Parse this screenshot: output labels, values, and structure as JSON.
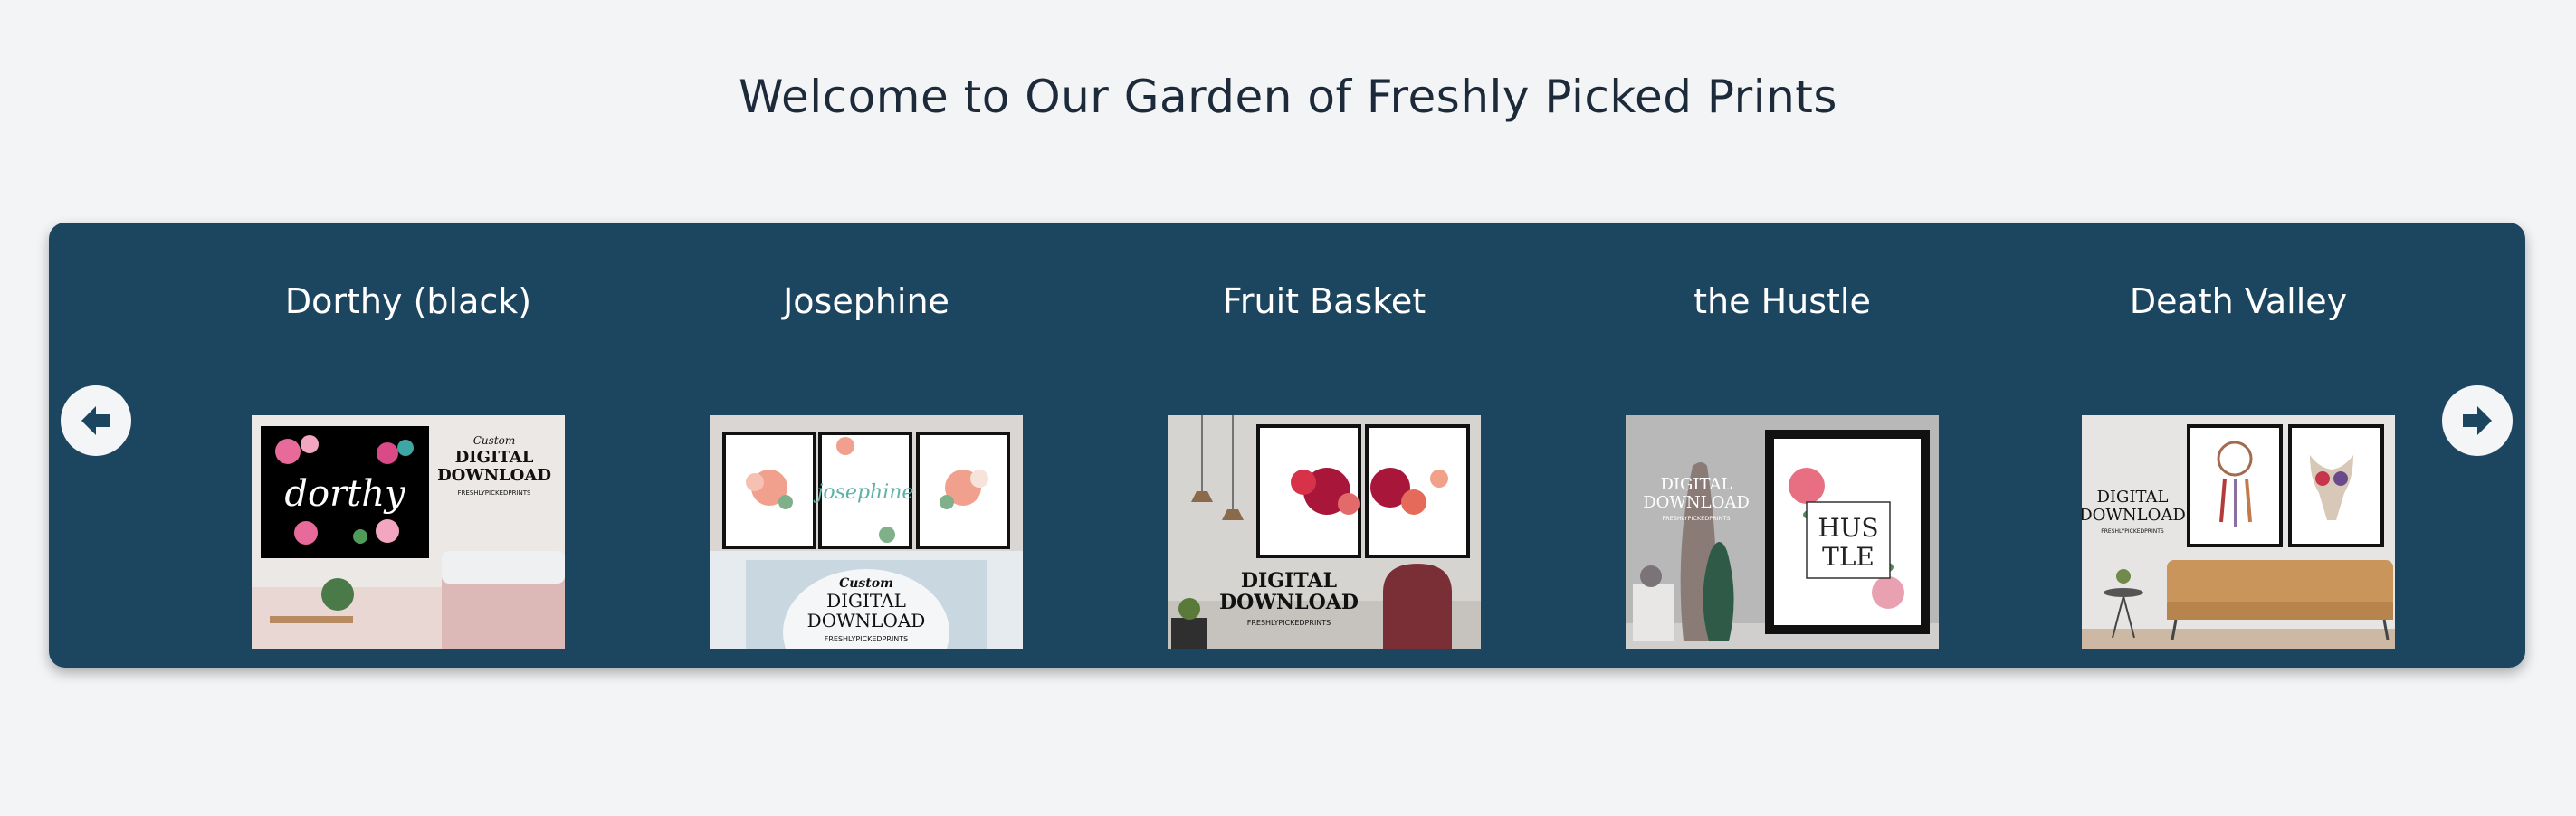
{
  "page": {
    "title": "Welcome to Our Garden of Freshly Picked Prints"
  },
  "carousel": {
    "prev_icon": "arrow-left-circle-icon",
    "next_icon": "arrow-right-circle-icon",
    "colors": {
      "panel": "#1c4560",
      "nav_button": "#f4f5f7",
      "title_text": "#ffffff"
    },
    "items": [
      {
        "title": "Dorthy (black)",
        "img_text_1": "Custom",
        "img_text_2": "DIGITAL",
        "img_text_3": "DOWNLOAD",
        "img_text_4": "FRESHLYPICKEDPRINTS",
        "img_text_5": "dorthy"
      },
      {
        "title": "Josephine",
        "img_text_1": "josephine",
        "img_text_2": "Custom",
        "img_text_3": "DIGITAL",
        "img_text_4": "DOWNLOAD",
        "img_text_5": "FRESHLYPICKEDPRINTS"
      },
      {
        "title": "Fruit Basket",
        "img_text_1": "DIGITAL",
        "img_text_2": "DOWNLOAD",
        "img_text_3": "FRESHLYPICKEDPRINTS"
      },
      {
        "title": "the Hustle",
        "img_text_1": "DIGITAL",
        "img_text_2": "DOWNLOAD",
        "img_text_3": "FRESHLYPICKEDPRINTS",
        "img_text_4": "HUS",
        "img_text_5": "TLE"
      },
      {
        "title": "Death Valley",
        "img_text_1": "DIGITAL",
        "img_text_2": "DOWNLOAD",
        "img_text_3": "FRESHLYPICKEDPRINTS"
      }
    ]
  }
}
